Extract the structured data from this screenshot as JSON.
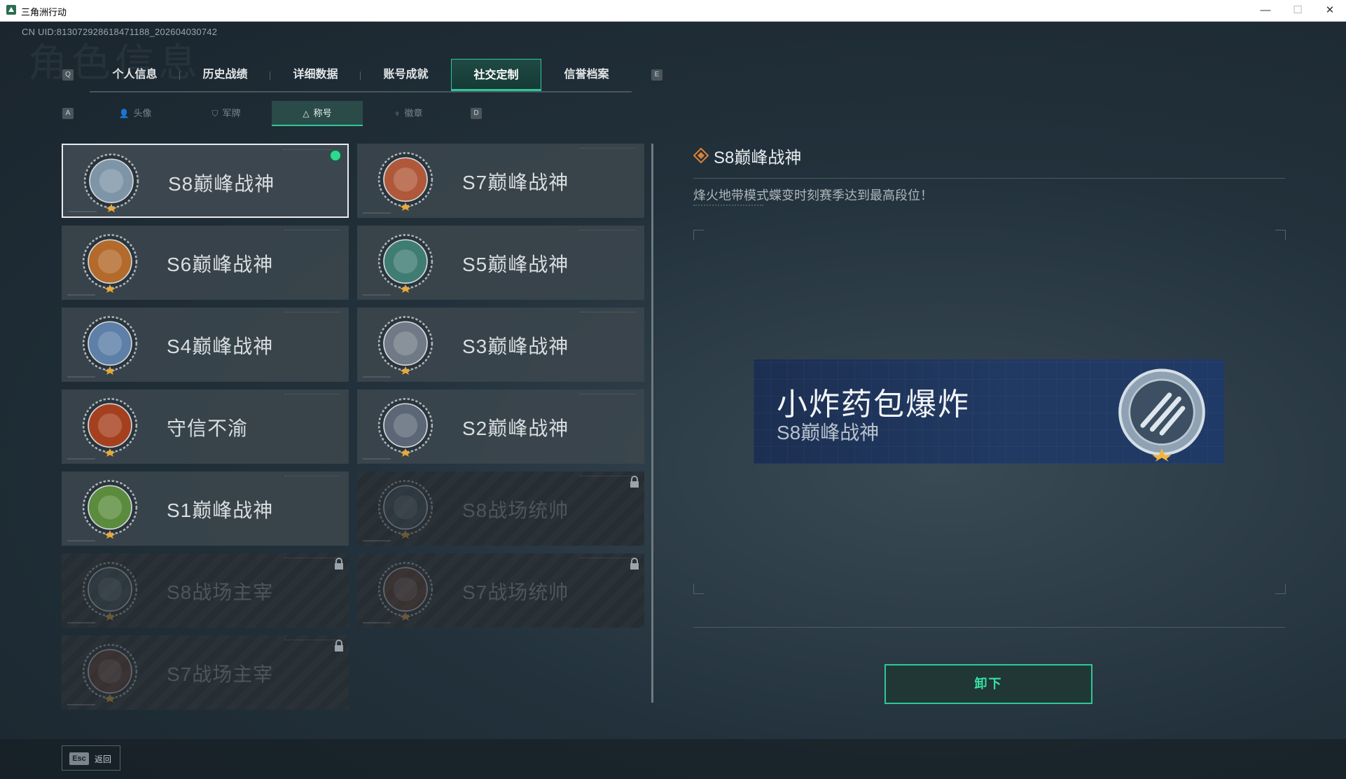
{
  "window": {
    "title": "三角洲行动"
  },
  "uid": "CN UID:8130729286184711​88_202604030742",
  "bg_title": "角色信息",
  "main_tabs": {
    "prev_key": "Q",
    "next_key": "E",
    "items": [
      {
        "label": "个人信息"
      },
      {
        "label": "历史战绩"
      },
      {
        "label": "详细数据"
      },
      {
        "label": "账号成就"
      },
      {
        "label": "社交定制",
        "active": true
      },
      {
        "label": "信誉档案"
      }
    ]
  },
  "sub_tabs": {
    "prev_key": "A",
    "next_key": "D",
    "items": [
      {
        "label": "头像",
        "icon": "person-icon"
      },
      {
        "label": "军牌",
        "icon": "tag-icon"
      },
      {
        "label": "称号",
        "icon": "triangle-icon",
        "active": true
      },
      {
        "label": "徽章",
        "icon": "emblem-icon"
      }
    ]
  },
  "titles": [
    {
      "name": "S8巅峰战神",
      "state": "equipped",
      "badge_color": "#7e95a8",
      "icon": "s8-peak-badge-icon"
    },
    {
      "name": "S7巅峰战神",
      "state": "owned",
      "badge_color": "#b0583a",
      "icon": "s7-peak-badge-icon"
    },
    {
      "name": "S6巅峰战神",
      "state": "owned",
      "badge_color": "#b36a2a",
      "icon": "s6-peak-badge-icon"
    },
    {
      "name": "S5巅峰战神",
      "state": "owned",
      "badge_color": "#3f7c74",
      "icon": "s5-peak-badge-icon"
    },
    {
      "name": "S4巅峰战神",
      "state": "owned",
      "badge_color": "#5d7fa8",
      "icon": "s4-peak-badge-icon"
    },
    {
      "name": "S3巅峰战神",
      "state": "owned",
      "badge_color": "#6f7a86",
      "icon": "s3-peak-badge-icon"
    },
    {
      "name": "守信不渝",
      "state": "owned",
      "badge_color": "#a5401f",
      "icon": "scales-badge-icon"
    },
    {
      "name": "S2巅峰战神",
      "state": "owned",
      "badge_color": "#5b6676",
      "icon": "s2-peak-badge-icon"
    },
    {
      "name": "S1巅峰战神",
      "state": "owned",
      "badge_color": "#5b8b3c",
      "icon": "s1-peak-badge-icon"
    },
    {
      "name": "S8战场统帅",
      "state": "locked",
      "badge_color": "#3a4a55",
      "icon": "tank-badge-icon"
    },
    {
      "name": "S8战场主宰",
      "state": "locked",
      "badge_color": "#3a4a55",
      "icon": "building-badge-icon"
    },
    {
      "name": "S7战场统帅",
      "state": "locked",
      "badge_color": "#5a3a30",
      "icon": "vehicle-badge-icon"
    },
    {
      "name": "S7战场主宰",
      "state": "locked",
      "badge_color": "#5a3a30",
      "icon": "warrior-badge-icon"
    }
  ],
  "detail": {
    "title": "S8巅峰战神",
    "description": "烽火地带模式蝶变时刻赛季达到最高段位！",
    "banner": {
      "player_name": "小炸药包爆炸",
      "title": "S8巅峰战神"
    },
    "button": "卸下"
  },
  "footer": {
    "key": "Esc",
    "label": "返回"
  },
  "colors": {
    "accent": "#2ec79a",
    "equipped_dot": "#2fd88f",
    "banner_bg": "#213a63"
  }
}
